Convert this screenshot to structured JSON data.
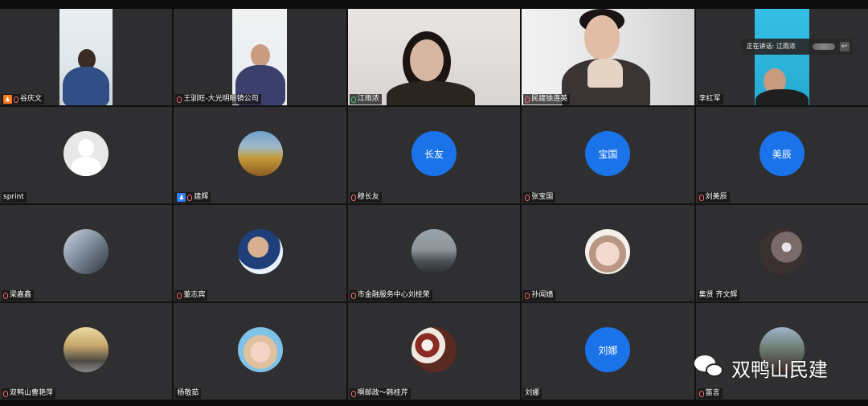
{
  "speaking_indicator": "正在讲话: 江雨浓",
  "watermark": "双鸭山民建",
  "colors": {
    "tile_bg": "#2f2f31",
    "avatar_blue": "#1a73e8",
    "active_border": "#3fc57a"
  },
  "tiles": [
    {
      "name": "谷庆文",
      "video": true,
      "host_badge": "orange"
    },
    {
      "name": "王驯旺-大光明眼镜公司",
      "video": true
    },
    {
      "name": "江雨浓",
      "video": true,
      "active": true
    },
    {
      "name": "民建徐连英",
      "video": true
    },
    {
      "name": "李红军",
      "video": true
    },
    {
      "name": "sprint",
      "avatar": "default-person-icon"
    },
    {
      "name": "建辉",
      "avatar": "landscape-photo",
      "host_badge": "blue"
    },
    {
      "name": "穆长友",
      "avatar_text": "长友"
    },
    {
      "name": "张宝国",
      "avatar_text": "宝国"
    },
    {
      "name": "刘美辰",
      "avatar_text": "美辰"
    },
    {
      "name": "梁嘉鑫",
      "avatar": "people-photo"
    },
    {
      "name": "董志宾",
      "avatar": "portrait-photo"
    },
    {
      "name": "市金融服务中心刘桂荣",
      "avatar": "mountain-photo"
    },
    {
      "name": "孙闻嫱",
      "avatar": "cartoon-photo"
    },
    {
      "name": "集贤 齐文辉",
      "avatar": "flower-photo"
    },
    {
      "name": "双鸭山曹艳萍",
      "avatar": "building-photo"
    },
    {
      "name": "杨敬茹",
      "avatar": "doll-photo"
    },
    {
      "name": "啊邮政～韩桂芹",
      "avatar": "food-photo"
    },
    {
      "name": "刘娜",
      "avatar_text": "刘娜"
    },
    {
      "name": "笛言",
      "avatar": "woman-photo"
    }
  ]
}
